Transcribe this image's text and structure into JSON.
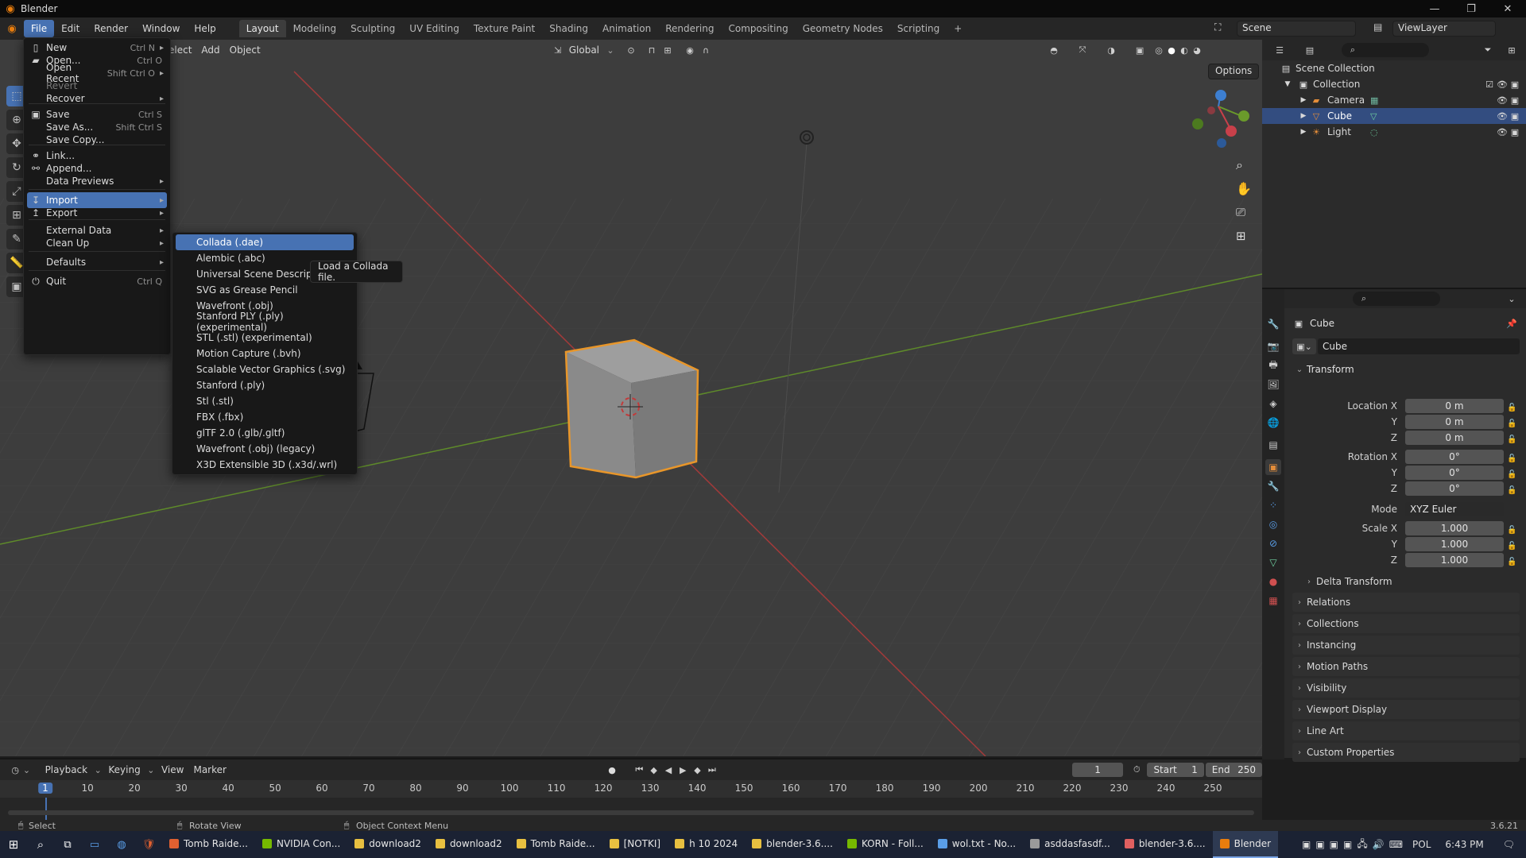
{
  "window": {
    "title": "Blender",
    "controls": [
      "—",
      "❐",
      "✕"
    ]
  },
  "menubar": {
    "items": [
      "File",
      "Edit",
      "Render",
      "Window",
      "Help"
    ],
    "active": "File"
  },
  "workspaces": [
    "Layout",
    "Modeling",
    "Sculpting",
    "UV Editing",
    "Texture Paint",
    "Shading",
    "Animation",
    "Rendering",
    "Compositing",
    "Geometry Nodes",
    "Scripting",
    "+"
  ],
  "active_workspace": "Layout",
  "scene": {
    "name": "Scene",
    "view_layer": "ViewLayer"
  },
  "viewport_header": {
    "menus": [
      "elect",
      "Add",
      "Object"
    ],
    "orientation": "Global",
    "options_label": "Options"
  },
  "file_menu": {
    "items": [
      {
        "label": "New",
        "shortcut": "Ctrl N",
        "icon": "file-new-icon",
        "arrow": "▸"
      },
      {
        "label": "Open...",
        "shortcut": "Ctrl O",
        "icon": "folder-icon"
      },
      {
        "label": "Open Recent",
        "shortcut": "Shift Ctrl O",
        "arrow": "▸"
      },
      {
        "label": "Revert",
        "shortcut": "",
        "dim": true
      },
      {
        "label": "Recover",
        "shortcut": "",
        "arrow": "▸"
      },
      {
        "label": "Save",
        "shortcut": "Ctrl S",
        "icon": "save-icon"
      },
      {
        "label": "Save As...",
        "shortcut": "Shift Ctrl S"
      },
      {
        "label": "Save Copy...",
        "shortcut": ""
      },
      {
        "label": "Link...",
        "shortcut": "",
        "icon": "link-icon"
      },
      {
        "label": "Append...",
        "shortcut": "",
        "icon": "append-icon"
      },
      {
        "label": "Data Previews",
        "shortcut": "",
        "arrow": "▸"
      },
      {
        "label": "Import",
        "shortcut": "",
        "icon": "import-icon",
        "arrow": "▸"
      },
      {
        "label": "Export",
        "shortcut": "",
        "icon": "export-icon",
        "arrow": "▸"
      },
      {
        "label": "External Data",
        "shortcut": "",
        "arrow": "▸"
      },
      {
        "label": "Clean Up",
        "shortcut": "",
        "arrow": "▸"
      },
      {
        "label": "Defaults",
        "shortcut": "",
        "arrow": "▸"
      },
      {
        "label": "Quit",
        "shortcut": "Ctrl Q",
        "icon": "power-icon"
      }
    ]
  },
  "import_menu": {
    "items": [
      "Collada (.dae)",
      "Alembic (.abc)",
      "Universal Scene Descriptior",
      "SVG as Grease Pencil",
      "Wavefront (.obj)",
      "Stanford PLY (.ply) (experimental)",
      "STL (.stl) (experimental)",
      "Motion Capture (.bvh)",
      "Scalable Vector Graphics (.svg)",
      "Stanford (.ply)",
      "Stl (.stl)",
      "FBX (.fbx)",
      "glTF 2.0 (.glb/.gltf)",
      "Wavefront (.obj) (legacy)",
      "X3D Extensible 3D (.x3d/.wrl)"
    ]
  },
  "tooltip": "Load a Collada file.",
  "outliner": {
    "root": "Scene Collection",
    "collection": "Collection",
    "objects": [
      "Camera",
      "Cube",
      "Light"
    ],
    "selected": "Cube"
  },
  "properties": {
    "object_name": "Cube",
    "datablock": "Cube",
    "transform_header": "Transform",
    "location_label": "Location X",
    "rotation_label": "Rotation X",
    "scale_label": "Scale X",
    "y_label": "Y",
    "z_label": "Z",
    "mode_label": "Mode",
    "location": [
      "0 m",
      "0 m",
      "0 m"
    ],
    "rotation": [
      "0°",
      "0°",
      "0°"
    ],
    "mode": "XYZ Euler",
    "scale": [
      "1.000",
      "1.000",
      "1.000"
    ],
    "delta_transform": "Delta Transform",
    "panels": [
      "Relations",
      "Collections",
      "Instancing",
      "Motion Paths",
      "Visibility",
      "Viewport Display",
      "Line Art",
      "Custom Properties"
    ]
  },
  "timeline": {
    "menus": [
      "Playback",
      "Keying",
      "View",
      "Marker"
    ],
    "current_frame": "1",
    "start_label": "Start",
    "start": "1",
    "end_label": "End",
    "end": "250",
    "ruler": [
      "1",
      "10",
      "20",
      "30",
      "40",
      "50",
      "60",
      "70",
      "80",
      "90",
      "100",
      "110",
      "120",
      "130",
      "140",
      "150",
      "160",
      "170",
      "180",
      "190",
      "200",
      "210",
      "220",
      "230",
      "240",
      "250"
    ]
  },
  "statusbar": {
    "left": "Select",
    "middle": "Rotate View",
    "right": "Object Context Menu",
    "version": "3.6.21"
  },
  "taskbar": {
    "items": [
      "Tomb Raide...",
      "NVIDIA Con...",
      "download2",
      "download2",
      "Tomb Raide...",
      "[NOTKI]",
      "h 10 2024",
      "blender-3.6....",
      "KORN - Foll...",
      "wol.txt - No...",
      "asddasfasdf...",
      "blender-3.6....",
      "Blender"
    ],
    "language": "POL",
    "time": "6:43 PM"
  },
  "colors": {
    "accent": "#4772b3",
    "selection_outline": "#e8962a",
    "x_axis": "#c8404a",
    "y_axis": "#6a9a2b",
    "z_axis": "#3d7fd1"
  }
}
